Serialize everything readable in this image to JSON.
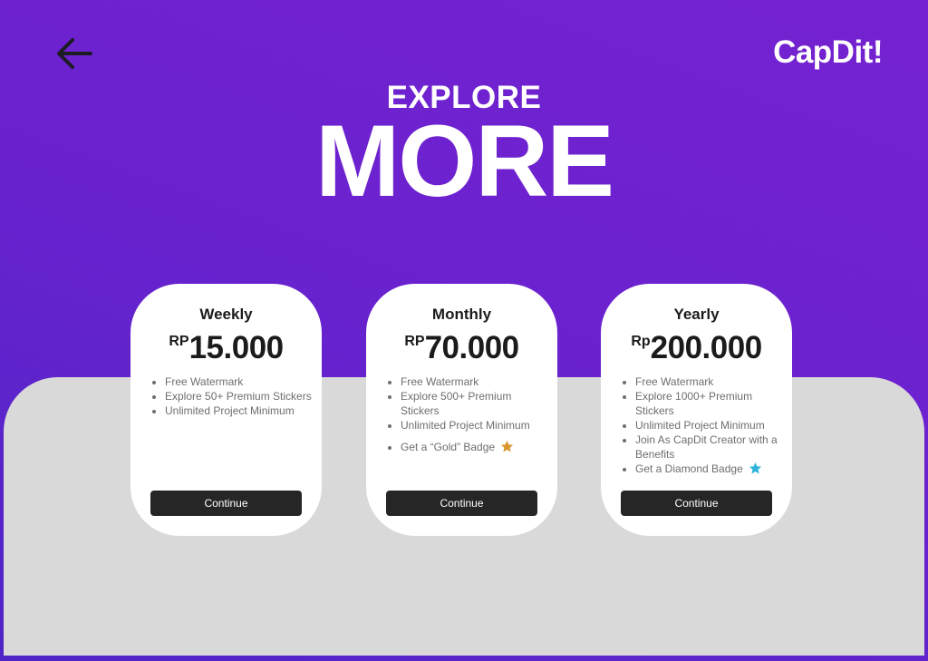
{
  "header": {
    "back_icon": "arrow-left-icon",
    "logo": "CapDit!",
    "explore": "EXPLORE",
    "more": "MORE"
  },
  "colors": {
    "background": "#6b22cf",
    "panel": "#d9d9d9",
    "button": "#262626",
    "gold_star": "#d9962b",
    "diamond_star": "#2eb5d9"
  },
  "plans": [
    {
      "title": "Weekly",
      "currency": "RP",
      "amount": "15.000",
      "features": [
        "Free Watermark",
        "Explore 50+ Premium Stickers",
        "Unlimited Project Minimum"
      ],
      "continue_label": "Continue"
    },
    {
      "title": "Monthly",
      "currency": "RP",
      "amount": "70.000",
      "features": [
        "Free Watermark",
        "Explore 500+ Premium Stickers",
        "Unlimited Project Minimum"
      ],
      "badge": "Get a “Gold” Badge",
      "badge_icon": "star-icon",
      "continue_label": "Continue"
    },
    {
      "title": "Yearly",
      "currency": "Rp",
      "amount": "200.000",
      "features": [
        "Free Watermark",
        "Explore 1000+ Premium Stickers",
        "Unlimited Project Minimum"
      ],
      "creator": "Join As CapDit Creator with a Benefits",
      "badge": "Get a Diamond Badge",
      "badge_icon": "star-icon",
      "continue_label": "Continue"
    }
  ]
}
